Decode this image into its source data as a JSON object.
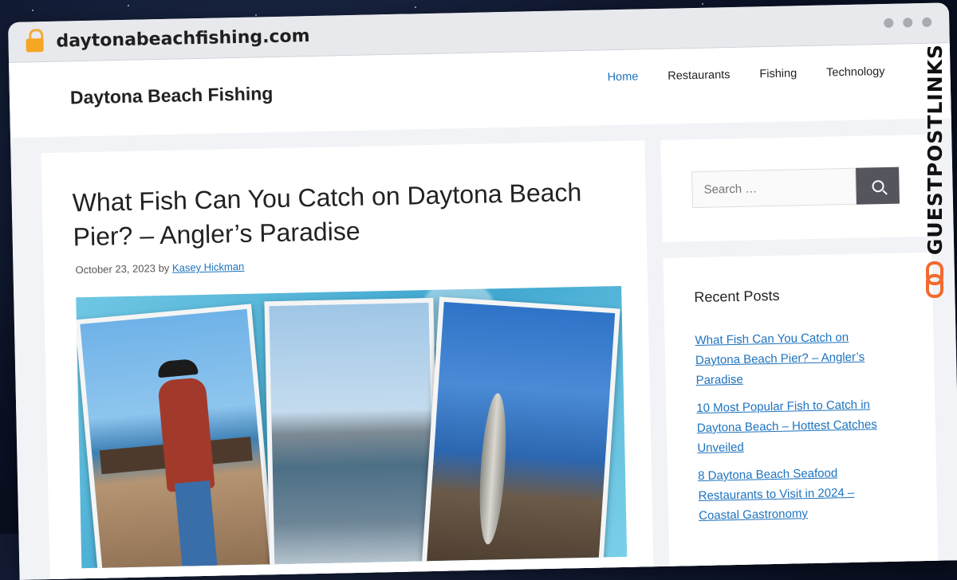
{
  "browser": {
    "url": "daytonabeachfishing.com"
  },
  "header": {
    "site_title": "Daytona Beach Fishing",
    "nav": [
      {
        "label": "Home",
        "active": true
      },
      {
        "label": "Restaurants",
        "active": false
      },
      {
        "label": "Fishing",
        "active": false
      },
      {
        "label": "Technology",
        "active": false
      }
    ]
  },
  "post": {
    "title": "What Fish Can You Catch on Daytona Beach Pier? – Angler’s Paradise",
    "date": "October 23, 2023",
    "by": "by",
    "author": "Kasey Hickman"
  },
  "search": {
    "placeholder": "Search …"
  },
  "recent_posts": {
    "title": "Recent Posts",
    "items": [
      "What Fish Can You Catch on Daytona Beach Pier? – Angler’s Paradise",
      "10 Most Popular Fish to Catch in Daytona Beach – Hottest Catches Unveiled",
      "8 Daytona Beach Seafood Restaurants to Visit in 2024 – Coastal Gastronomy"
    ]
  },
  "watermark": {
    "text": "GUESTPOSTLINKS"
  },
  "colors": {
    "link": "#1e73be",
    "accent_orange": "#f26a2e",
    "search_button": "#55555e"
  }
}
